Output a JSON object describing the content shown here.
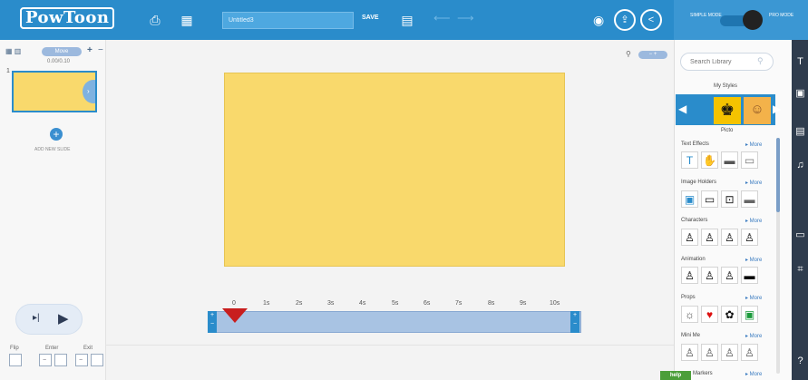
{
  "header": {
    "logo_text": "PowToon",
    "title_value": "Untitled3",
    "save_label": "SAVE",
    "mode_simple": "SIMPLE MODE",
    "mode_pro": "PRO MODE"
  },
  "slides": {
    "time": "0.00/0.10",
    "slide_number": "1",
    "add_new_slide": "ADD NEW SLIDE",
    "move_label": "Move"
  },
  "playback": {
    "flip_label": "Flip",
    "enter_label": "Enter",
    "exit_label": "Exit"
  },
  "timeline": {
    "ticks": [
      "0",
      "1s",
      "2s",
      "3s",
      "4s",
      "5s",
      "6s",
      "7s",
      "8s",
      "9s",
      "10s"
    ]
  },
  "library": {
    "search_placeholder": "Search Library",
    "my_styles": "My Styles",
    "picto_label": "Picto",
    "more_label": "▸ More",
    "sections": [
      "Text Effects",
      "Image Holders",
      "Characters",
      "Animation",
      "Props",
      "Mini Me",
      "Markers"
    ],
    "help_label": "help"
  },
  "icons": {
    "logo": "powtoon-logo-icon",
    "doc": "document-icon",
    "slides": "slides-icon",
    "export": "export-icon",
    "undo": "undo-icon",
    "redo": "redo-icon",
    "preview": "eye-icon",
    "publish": "publish-icon",
    "share": "share-icon"
  },
  "colors": {
    "topbar": "#2a8ccb",
    "canvas": "#f9d96c",
    "playhead": "#c81e1e",
    "toolstrip": "#2f3c4d",
    "help": "#4b9e39"
  }
}
